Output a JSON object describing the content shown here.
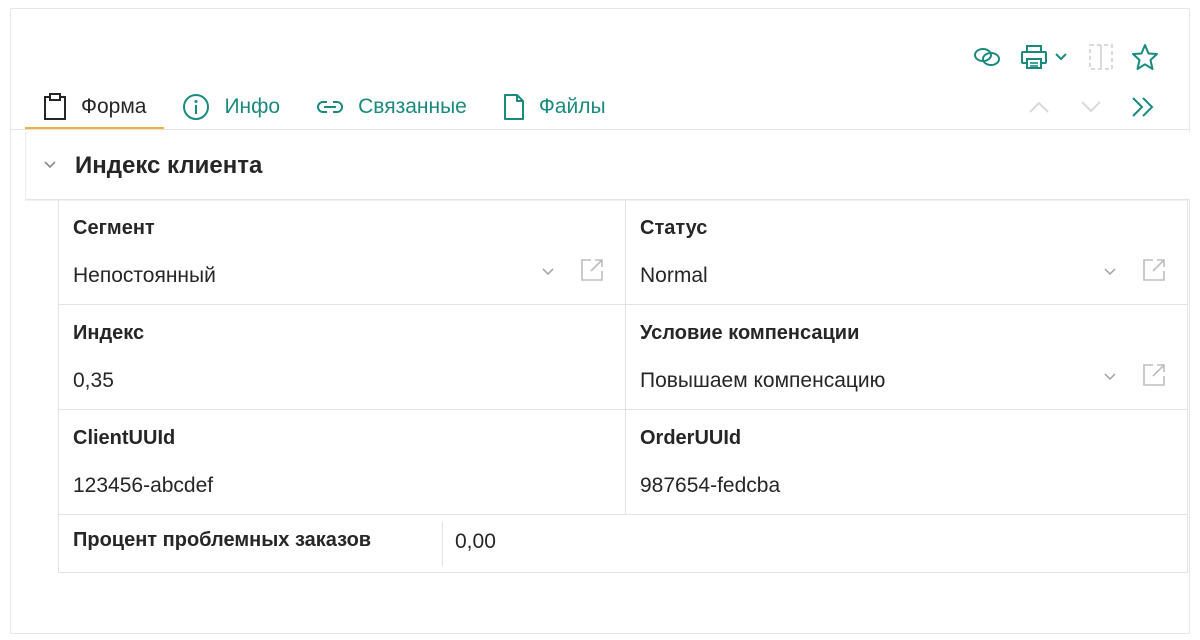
{
  "toolbar": {
    "icons": [
      "link-icon",
      "print-icon",
      "chevron-down-icon",
      "split-view-icon",
      "star-icon"
    ],
    "accent_color": "#1a8a7e",
    "disabled_color": "#d9d9d9"
  },
  "tabs": [
    {
      "label": "Форма",
      "icon": "clipboard-icon",
      "active": true
    },
    {
      "label": "Инфо",
      "icon": "info-icon",
      "active": false
    },
    {
      "label": "Связанные",
      "icon": "link-icon",
      "active": false
    },
    {
      "label": "Файлы",
      "icon": "document-icon",
      "active": false
    }
  ],
  "active_tab_underline_color": "#e8b53a",
  "section": {
    "title": "Индекс клиента"
  },
  "fields": {
    "segment": {
      "label": "Сегмент",
      "value": "Непостоянный"
    },
    "status": {
      "label": "Статус",
      "value": "Normal"
    },
    "index": {
      "label": "Индекс",
      "value": "0,35"
    },
    "compensation": {
      "label": "Условие компенсации",
      "value": "Повышаем компенсацию"
    },
    "client_uuid": {
      "label": "ClientUUId",
      "value": "123456-abcdef"
    },
    "order_uuid": {
      "label": "OrderUUId",
      "value": "987654-fedcba"
    },
    "problem_orders": {
      "label": "Процент проблемных заказов",
      "value": "0,00"
    }
  }
}
